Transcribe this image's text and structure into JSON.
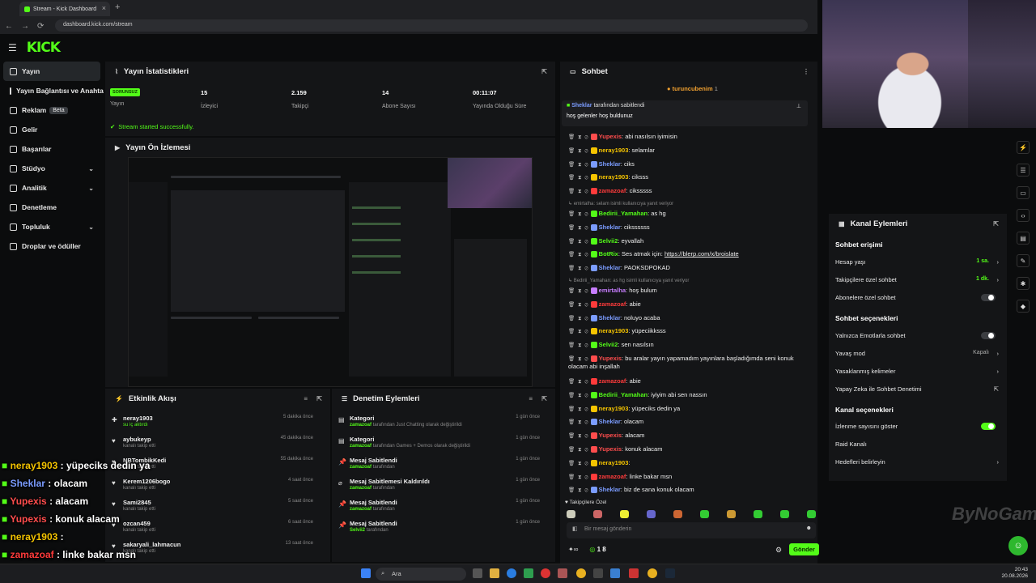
{
  "browser": {
    "tab_title": "Stream - Kick Dashboard",
    "url": "dashboard.kick.com/stream"
  },
  "brand": {
    "logo": "KICK",
    "accent": "#53fc18"
  },
  "sidebar": {
    "items": [
      {
        "label": "Yayın",
        "icon": "broadcast-icon",
        "active": true
      },
      {
        "label": "Yayın Bağlantısı ve Anahtar",
        "icon": "link-icon"
      },
      {
        "label": "Reklam",
        "icon": "ad-icon",
        "badge": "Beta"
      },
      {
        "label": "Gelir",
        "icon": "money-icon"
      },
      {
        "label": "Başarılar",
        "icon": "trophy-icon"
      },
      {
        "label": "Stüdyo",
        "icon": "studio-icon",
        "expandable": true
      },
      {
        "label": "Analitik",
        "icon": "chart-icon",
        "expandable": true
      },
      {
        "label": "Denetleme",
        "icon": "shield-icon"
      },
      {
        "label": "Topluluk",
        "icon": "people-icon",
        "expandable": true
      },
      {
        "label": "Droplar ve ödüller",
        "icon": "gift-icon"
      }
    ]
  },
  "stats": {
    "title": "Yayın İstatistikleri",
    "badge": "SORUNSUZ",
    "items": [
      {
        "value": "",
        "label": "Yayın"
      },
      {
        "value": "15",
        "label": "İzleyici"
      },
      {
        "value": "2.159",
        "label": "Takipçi"
      },
      {
        "value": "14",
        "label": "Abone Sayısı"
      },
      {
        "value": "00:11:07",
        "label": "Yayında Olduğu Süre"
      }
    ],
    "success": "Stream started successfully."
  },
  "preview": {
    "title": "Yayın Ön İzlemesi"
  },
  "activity": {
    "title": "Etkinlik Akışı",
    "items": [
      {
        "name": "neray1903",
        "sub": "su iç aktırdı",
        "time": "5 dakika önce",
        "green": true
      },
      {
        "name": "aybukeyp",
        "sub": "kanalı takip etti",
        "time": "45 dakika önce"
      },
      {
        "name": "NBTombikKedi",
        "sub": "kanalı takip etti",
        "time": "55 dakika önce"
      },
      {
        "name": "Kerem1206bogo",
        "sub": "kanalı takip etti",
        "time": "4 saat önce"
      },
      {
        "name": "Sami2845",
        "sub": "kanalı takip etti",
        "time": "5 saat önce"
      },
      {
        "name": "ozcan459",
        "sub": "kanalı takip etti",
        "time": "6 saat önce"
      },
      {
        "name": "sakaryali_lahmacun",
        "sub": "kanalı takip etti",
        "time": "13 saat önce"
      }
    ]
  },
  "moderation": {
    "title": "Denetim Eylemleri",
    "items": [
      {
        "title": "Kategori",
        "actor": "zamazoaf",
        "desc": "tarafından Just Chatting olarak değiştirildi",
        "time": "1 gün önce"
      },
      {
        "title": "Kategori",
        "actor": "zamazoaf",
        "desc": "tarafından Games + Demos olarak değiştirildi",
        "time": "1 gün önce"
      },
      {
        "title": "Mesaj Sabitlendi",
        "actor": "zamazoaf",
        "desc": "tarafından",
        "time": "1 gün önce"
      },
      {
        "title": "Mesaj Sabitlemesi Kaldırıldı",
        "actor": "zamazoaf",
        "desc": "tarafından",
        "time": "1 gün önce"
      },
      {
        "title": "Mesaj Sabitlendi",
        "actor": "zamazoaf",
        "desc": "tarafından",
        "time": "1 gün önce"
      },
      {
        "title": "Mesaj Sabitlendi",
        "actor": "Selvii2",
        "desc": "tarafından",
        "time": "1 gün önce"
      }
    ]
  },
  "chat": {
    "title": "Sohbet",
    "top_user": "turuncubenim",
    "top_count": "1",
    "pinned_by": "Sheklar",
    "pinned_label": "tarafından sabitlendi",
    "pinned_text": "hoş gelenler hoş buldunuz",
    "messages": [
      {
        "user": "Yupexis",
        "color": "#ff4d4d",
        "text": "abi nasılsın iyimisin"
      },
      {
        "user": "neray1903",
        "color": "#f5c400",
        "text": "selamlar"
      },
      {
        "user": "Sheklar",
        "color": "#7b9cff",
        "text": "ciks"
      },
      {
        "user": "neray1903",
        "color": "#f5c400",
        "text": "ciksss"
      },
      {
        "user": "zamazoaf",
        "color": "#ff3b3b",
        "text": "ciksssss"
      },
      {
        "reply": "emirtalha: selam isimli kullanıcıya yanıt veriyor"
      },
      {
        "user": "Bedirii_Yamahan",
        "color": "#53fc18",
        "text": "as hg"
      },
      {
        "user": "Sheklar",
        "color": "#7b9cff",
        "text": "cikssssss"
      },
      {
        "user": "Selvii2",
        "color": "#53fc18",
        "text": "eyvallah"
      },
      {
        "user": "BotRix",
        "color": "#53fc18",
        "text": "Ses atmak için:",
        "link": "https://blerp.com/x/broislate"
      },
      {
        "user": "Sheklar",
        "color": "#7b9cff",
        "text": "PAOKSDPOKAD"
      },
      {
        "reply": "Bedirii_Yamahan: as hg isimli kullanıcıya yanıt veriyor"
      },
      {
        "user": "emirtalha",
        "color": "#c77dff",
        "text": "hoş bulum"
      },
      {
        "user": "zamazoaf",
        "color": "#ff3b3b",
        "text": "abie"
      },
      {
        "user": "Sheklar",
        "color": "#7b9cff",
        "text": "noluyo acaba"
      },
      {
        "user": "neray1903",
        "color": "#f5c400",
        "text": "yüpeciikksss"
      },
      {
        "user": "Selvii2",
        "color": "#53fc18",
        "text": "sen nasılsın"
      },
      {
        "user": "Yupexis",
        "color": "#ff4d4d",
        "text": "bu aralar yayın yapamadım yayınlara başladığımda seni konuk olacam abi inşallah"
      },
      {
        "user": "zamazoaf",
        "color": "#ff3b3b",
        "text": "abie"
      },
      {
        "user": "Bedirii_Yamahan",
        "color": "#53fc18",
        "text": "iyiyim abi sen nassın"
      },
      {
        "user": "neray1903",
        "color": "#f5c400",
        "text": "yüpeciks dedin ya"
      },
      {
        "user": "Sheklar",
        "color": "#7b9cff",
        "text": "olacam"
      },
      {
        "user": "Yupexis",
        "color": "#ff4d4d",
        "text": "alacam"
      },
      {
        "user": "Yupexis",
        "color": "#ff4d4d",
        "text": "konuk alacam"
      },
      {
        "user": "neray1903",
        "color": "#f5c400",
        "text": ""
      },
      {
        "user": "zamazoaf",
        "color": "#ff3b3b",
        "text": "linke bakar msn"
      },
      {
        "user": "Sheklar",
        "color": "#7b9cff",
        "text": "biz de sana konuk olacam"
      }
    ],
    "followers_only": "Takipçilere Özel",
    "input_placeholder": "Bir mesaj gönderin",
    "points": "1 8",
    "send": "Gönder"
  },
  "channel_actions": {
    "title": "Kanal Eylemleri",
    "chat_access": "Sohbet erişimi",
    "account_age": {
      "label": "Hesap yaşı",
      "value": "1 sa."
    },
    "followers_chat": {
      "label": "Takipçilere özel sohbet",
      "value": "1 dk."
    },
    "subs_chat": {
      "label": "Abonelere özel sohbet"
    },
    "chat_options": "Sohbet seçenekleri",
    "emote_only": {
      "label": "Yalnızca Emotlarla sohbet"
    },
    "slow_mode": {
      "label": "Yavaş mod",
      "value": "Kapalı"
    },
    "banned_words": {
      "label": "Yasaklanmış kelimeler"
    },
    "ai_moderation": {
      "label": "Yapay Zeka ile Sohbet Denetimi"
    },
    "channel_options": "Kanal seçenekleri",
    "show_viewers": {
      "label": "İzlenme sayısını göster"
    },
    "raid": {
      "label": "Raid Kanalı"
    },
    "goals": {
      "label": "Hedefleri belirleyin"
    }
  },
  "overlay_chat": [
    {
      "user": "neray1903",
      "color": "#f5c400",
      "text": ": yüpeciks dedin ya"
    },
    {
      "user": "Sheklar",
      "color": "#7b9cff",
      "text": ": olacam"
    },
    {
      "user": "Yupexis",
      "color": "#ff4d4d",
      "text": ": alacam"
    },
    {
      "user": "Yupexis",
      "color": "#ff4d4d",
      "text": ": konuk alacam"
    },
    {
      "user": "neray1903",
      "color": "#f5c400",
      "text": ":"
    },
    {
      "user": "zamazoaf",
      "color": "#ff3b3b",
      "text": ": linke bakar msn"
    },
    {
      "user": "Sheklar",
      "color": "#7b9cff",
      "text": ": biz de sana konuk olacam"
    }
  ],
  "watermark": "ByNoGame",
  "taskbar": {
    "search": "Ara",
    "time": "20:43",
    "date": "20.08.2026"
  }
}
